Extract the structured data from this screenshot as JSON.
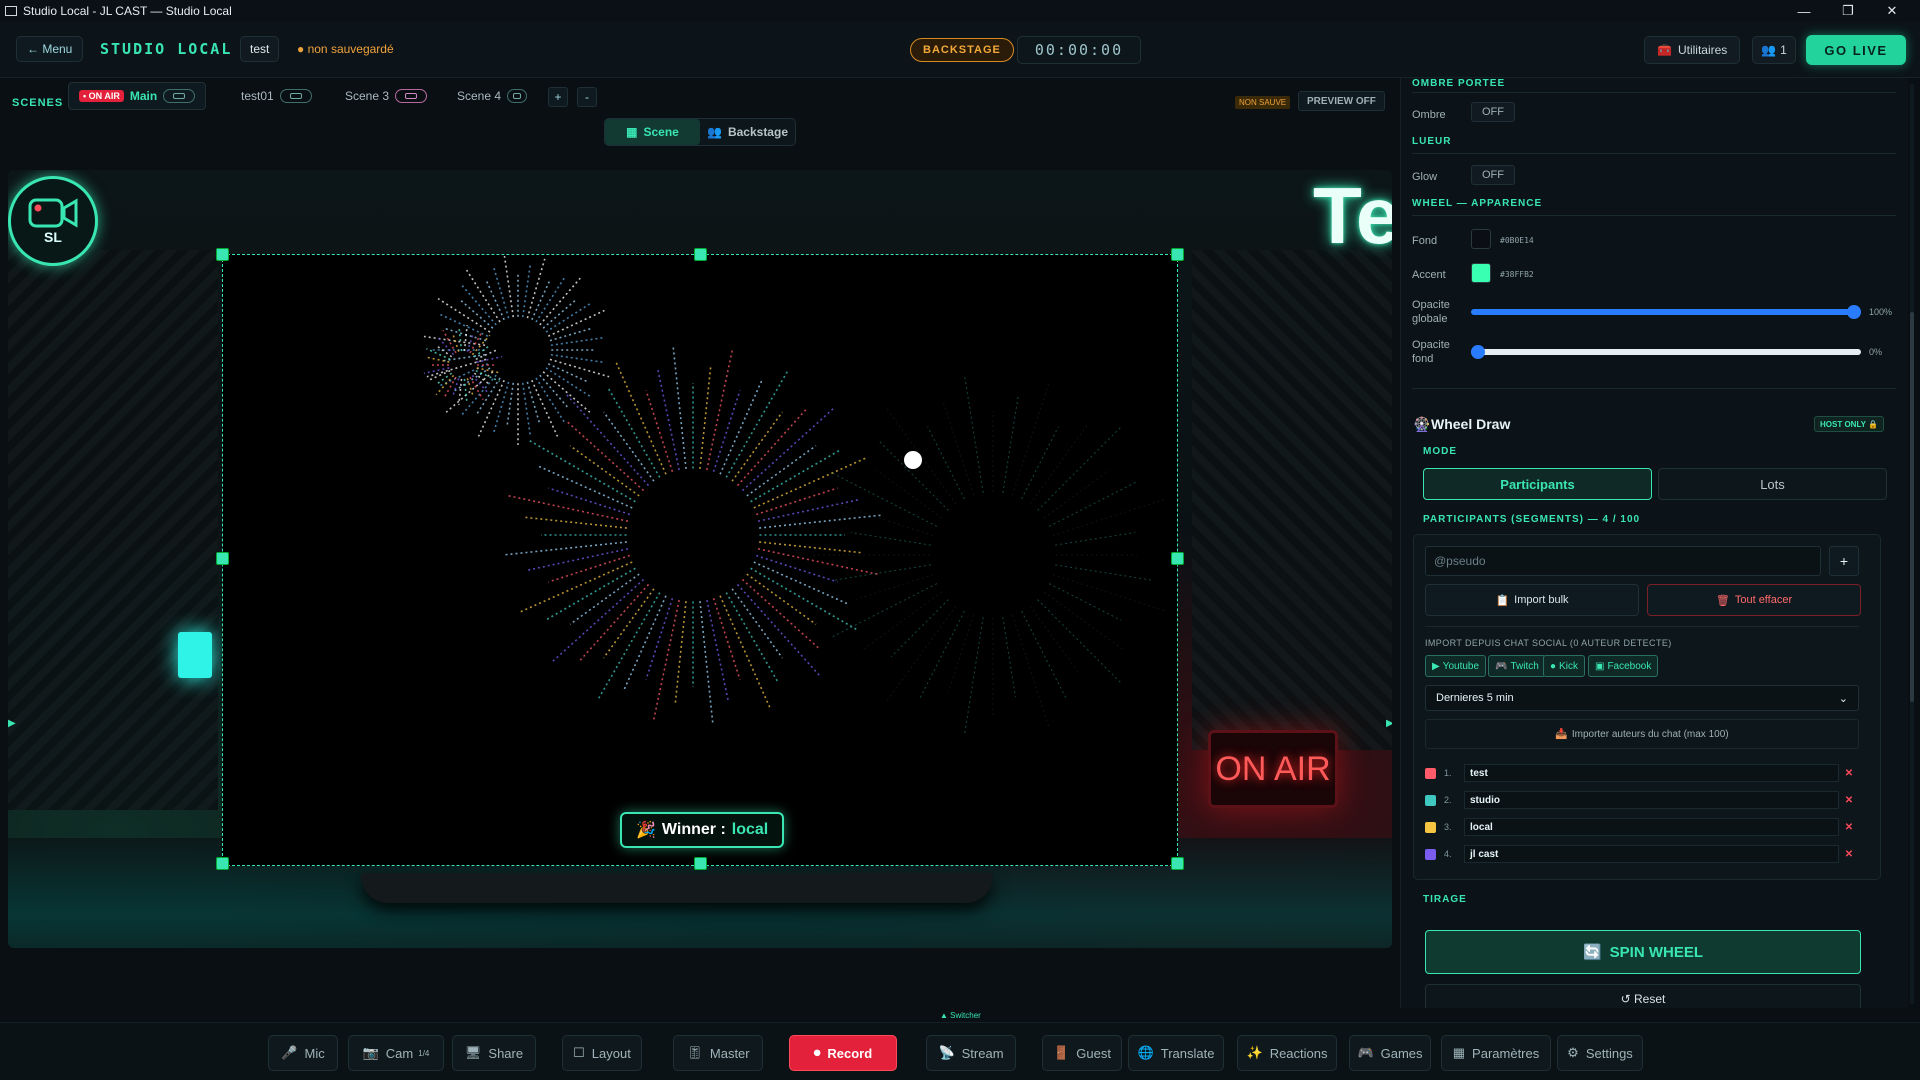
{
  "window": {
    "title": "Studio Local - JL CAST — Studio Local"
  },
  "header": {
    "menu_label": "← Menu",
    "brand": "STUDIO LOCAL",
    "project": "test",
    "unsaved": "● non sauvegardé",
    "backstage": "BACKSTAGE",
    "timer": "00:00:00",
    "utilities": "Utilitaires",
    "guest_count": "1",
    "go_live": "GO LIVE"
  },
  "scenes": {
    "label": "SCENES",
    "onair_badge": "• ON AIR",
    "tabs": [
      {
        "label": "Main"
      },
      {
        "label": "test01"
      },
      {
        "label": "Scene 3"
      },
      {
        "label": "Scene 4"
      }
    ],
    "add": "+",
    "remove": "-",
    "non_sauve": "NON SAUVE",
    "preview_off": "PREVIEW OFF",
    "switch": {
      "scene": "Scene",
      "backstage": "Backstage"
    }
  },
  "stage": {
    "logo_text": "SL",
    "banner_text": "Te",
    "onair_sign": "ON AIR",
    "winner_prefix": "Winner :",
    "winner_name": "local"
  },
  "panel": {
    "ombre_section": "OMBRE PORTEE",
    "ombre_label": "Ombre",
    "ombre_value": "OFF",
    "lueur_section": "LUEUR",
    "glow_label": "Glow",
    "glow_value": "OFF",
    "wheel_section": "WHEEL — APPARENCE",
    "fond_label": "Fond",
    "fond_hex": "#0B0E14",
    "accent_label": "Accent",
    "accent_hex": "#38FFB2",
    "opacite_globale_label": "Opacite globale",
    "opacite_globale_value": 100,
    "opacite_globale_pct": "100%",
    "opacite_fond_label": "Opacite fond",
    "opacite_fond_value": 0,
    "opacite_fond_pct": "0%",
    "wheel_draw_title": "Wheel Draw",
    "host_only": "HOST ONLY 🔒",
    "mode_section": "MODE",
    "mode_participants": "Participants",
    "mode_lots": "Lots",
    "participants_section": "PARTICIPANTS (SEGMENTS) — 4 / 100",
    "pseudo_placeholder": "@pseudo",
    "add_btn": "+",
    "import_bulk": "Import bulk",
    "clear_all": "Tout effacer",
    "import_chat_label": "IMPORT DEPUIS CHAT SOCIAL (0 AUTEUR DETECTE)",
    "socials": [
      "Youtube",
      "Twitch",
      "Kick",
      "Facebook"
    ],
    "period": "Dernieres 5 min",
    "import_authors": "Importer auteurs du chat (max 100)",
    "participants": [
      {
        "num": "1.",
        "name": "test",
        "color": "#ff5a6a"
      },
      {
        "num": "2.",
        "name": "studio",
        "color": "#3ec8c0"
      },
      {
        "num": "3.",
        "name": "local",
        "color": "#f5c542"
      },
      {
        "num": "4.",
        "name": "jl cast",
        "color": "#7a5cf0"
      }
    ],
    "tirage_section": "TIRAGE",
    "spin": "SPIN WHEEL",
    "reset": "↺ Reset"
  },
  "footer": {
    "switcher": "▲ Switcher",
    "buttons": {
      "mic": "Mic",
      "cam": "Cam",
      "cam_sup": "1/4",
      "share": "Share",
      "layout": "Layout",
      "master": "Master",
      "record": "Record",
      "stream": "Stream",
      "guest": "Guest",
      "translate": "Translate",
      "reactions": "Reactions",
      "games": "Games",
      "parametres": "Paramètres",
      "settings": "Settings"
    }
  }
}
